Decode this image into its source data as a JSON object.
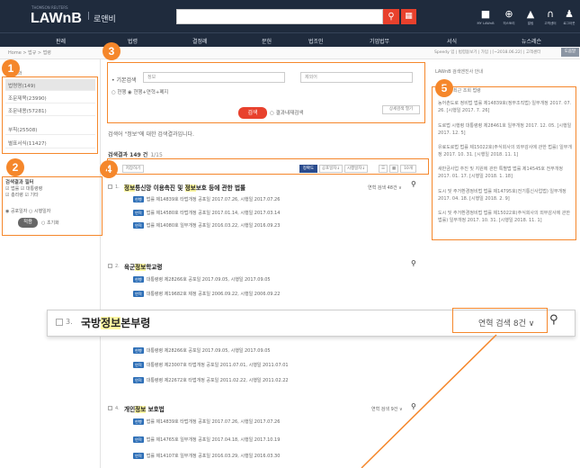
{
  "header": {
    "logo": "LAWnB",
    "logo_sub": "THOMSON REUTERS",
    "logo_sep": "|",
    "logo_kr": "로앤비",
    "icons": [
      {
        "glyph": "■",
        "label": "MY LAWnB",
        "name": "folder-icon"
      },
      {
        "glyph": "⊕",
        "label": "히스토리",
        "name": "history-icon"
      },
      {
        "glyph": "▲",
        "label": "알림",
        "name": "bell-icon"
      },
      {
        "glyph": "∩",
        "label": "고객센터",
        "name": "headset-icon"
      },
      {
        "glyph": "♟",
        "label": "로그아웃",
        "name": "user-icon"
      }
    ]
  },
  "nav": [
    "판례",
    "법령",
    "결정례",
    "문헌",
    "법조인",
    "기업법무",
    "서식",
    "뉴스레슨"
  ],
  "crumb": {
    "left": "Home > 법규 > 법령",
    "right": "Speedy 입 | 법령돋보기 | 가입 | [~2018.06.22] | 고객센터",
    "button": "도움말"
  },
  "left": {
    "title": "검색결과",
    "items": [
      "법령명(149)",
      "조문제목(23990)",
      "조문내용(57281)",
      "부칙(25508)",
      "별표서식(11427)"
    ],
    "filter_title": "검색결과 필터",
    "filter_rows": [
      "☑ 법률 ☑ 대통령령",
      "☑ 총리령 ☑ 기타",
      "◉ 공포일자 ○ 시행일자"
    ],
    "filter_select": "일자 선택",
    "apply": "적용",
    "reset": "○ 초기화"
  },
  "search": {
    "label": "• 기본검색",
    "query": "정보",
    "placeholder": "제외어",
    "options": "○ 현행 ◉ 현행+연혁+폐지",
    "submit": "검색",
    "within": "○ 결과내재검색",
    "detail": "상세검색 열기"
  },
  "results": {
    "message": "검색어 \"정보\"에 대한 검색결과입니다.",
    "count": "검색결과 149 건",
    "page": "1/15",
    "toolbar": {
      "save": "저장하기",
      "sort1": "정확도",
      "sort2": "공포일자↓",
      "sort3": "시행일자↓",
      "size": "10개"
    },
    "items": [
      {
        "num": "1.",
        "pre": "",
        "hl": "정보",
        "mid": "통신망 이용촉진 및 ",
        "hl2": "정보",
        "post": "보호 등에 관한 법률",
        "count": "연혁 검색 48건 ∨",
        "subs": [
          {
            "tag": "현행",
            "text": "법률 제14839호 타법개정 공포일 2017.07.26, 시행일 2017.07.26"
          },
          {
            "tag": "연혁",
            "text": "법률 제14580호 타법개정 공포일 2017.01.14, 시행일 2017.03.14"
          },
          {
            "tag": "연혁",
            "text": "법률 제14080호 일부개정 공포일 2016.03.22, 시행일 2016.09.23"
          }
        ]
      },
      {
        "num": "2.",
        "pre": "육군",
        "hl": "정보",
        "mid": "",
        "hl2": "",
        "post": "학교령",
        "count": "",
        "subs": [
          {
            "tag": "현행",
            "text": "대통령령 제28266호 공포일 2017.09.05, 시행일 2017.09.05"
          },
          {
            "tag": "연혁",
            "text": "대통령령 제19682호 제정 공포일 2006.09.22, 시행일 2006.09.22"
          }
        ]
      },
      {
        "num": "3.",
        "pre": "",
        "hl": "",
        "mid": "",
        "hl2": "",
        "post": "",
        "count": "",
        "subs": [
          {
            "tag": "현행",
            "text": "대통령령 제28266호 공포일 2017.09.05, 시행일 2017.09.05"
          },
          {
            "tag": "연혁",
            "text": "대통령령 제23007호 타법개정 공포일 2011.07.01, 시행일 2011.07.01"
          },
          {
            "tag": "연혁",
            "text": "대통령령 제22672호 타법개정 공포일 2011.02.22, 시행일 2011.02.22"
          }
        ]
      },
      {
        "num": "4.",
        "pre": "개인",
        "hl": "정보",
        "mid": "",
        "hl2": "",
        "post": " 보호법",
        "count": "연혁 검색 9건 ∨",
        "subs": [
          {
            "tag": "현행",
            "text": "법률 제14839호 타법개정 공포일 2017.07.26, 시행일 2017.07.26"
          },
          {
            "tag": "연혁",
            "text": "법률 제14765호 일부개정 공포일 2017.04.18, 시행일 2017.10.19"
          },
          {
            "tag": "연혁",
            "text": "법률 제14107호 일부개정 공포일 2016.03.29, 시행일 2016.03.30"
          }
        ]
      }
    ]
  },
  "zoom": {
    "num": "3.",
    "title_pre": "국방",
    "title_hl": "정보",
    "title_post": "본부령",
    "count": "연혁 검색 8건 ∨"
  },
  "right": {
    "top": "LAWnB 검색엔진사 안내",
    "box_title": "최근 조회 법령",
    "items": [
      "농어촌도로 정비법 법률 제14839호(정부조직법) 일부개정 2017. 07. 26. [시행일 2017. 7. 26]",
      "도로법 시행령 대통령령 제28461호 일부개정 2017. 12. 05. [시행일 2017. 12. 5]",
      "유료도로법 법률 제15022호(주식회사의 외부감사에 관한 법률) 일부개정 2017. 10. 31. [시행일 2018. 11. 1]",
      "새만금사업 추진 및 지원에 관한 특별법 법률 제14545호 전부개정 2017. 01. 17. [시행일 2018. 1. 18]",
      "도시 및 주거환경정비법 법률 제14795호(전기통신사업법) 일부개정 2017. 04. 18. [시행일 2018. 2. 9]",
      "도시 및 주거환경정비법 법률 제15022호(주식회사의 외부감사에 관한 법률) 일부개정 2017. 10. 31. [시행일 2018. 11. 1]"
    ]
  },
  "badges": [
    "1",
    "2",
    "3",
    "4",
    "5",
    "6"
  ],
  "colors": {
    "accent": "#f5872b",
    "header": "#1f2b3d",
    "button": "#e8412d",
    "tag": "#2e6fb7"
  }
}
